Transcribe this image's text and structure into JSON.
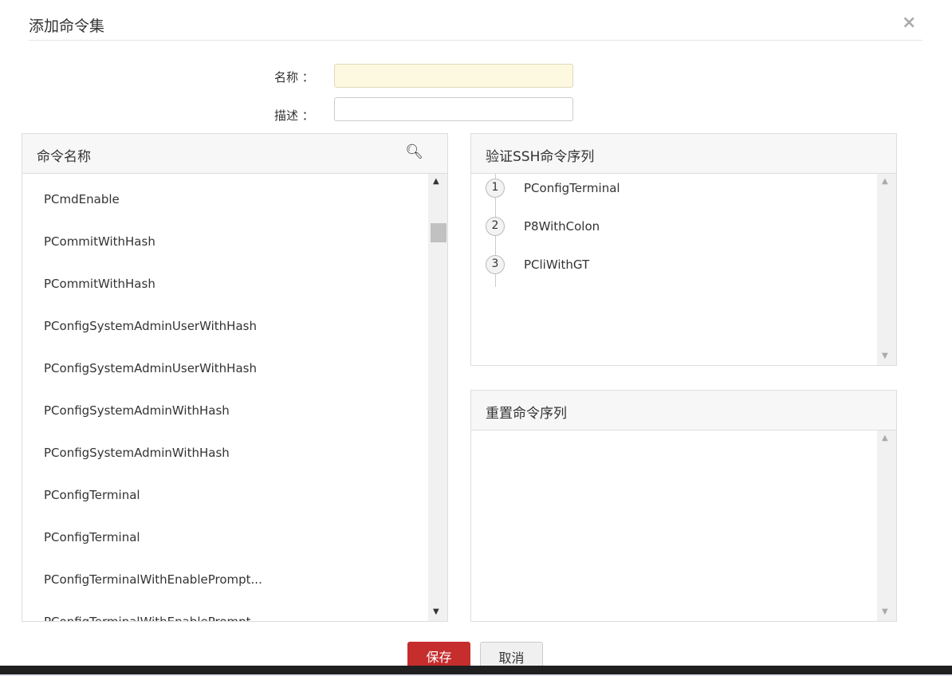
{
  "dialog": {
    "title": "添加命令集",
    "close_icon": "×"
  },
  "form": {
    "name_label": "名称 ：",
    "name_value": "",
    "desc_label": "描述 ：",
    "desc_value": ""
  },
  "commands": {
    "header": "命令名称",
    "items": [
      "PCmdEnable",
      "PCommitWithHash",
      "PCommitWithHash",
      "PConfigSystemAdminUserWithHash",
      "PConfigSystemAdminUserWithHash",
      "PConfigSystemAdminWithHash",
      "PConfigSystemAdminWithHash",
      "PConfigTerminal",
      "PConfigTerminal",
      "PConfigTerminalWithEnablePrompt...",
      "PConfigTerminalWithEnablePrompt..."
    ]
  },
  "verify": {
    "header": "验证SSH命令序列",
    "steps": [
      {
        "n": "1",
        "name": "PConfigTerminal"
      },
      {
        "n": "2",
        "name": "P8WithColon"
      },
      {
        "n": "3",
        "name": "PCliWithGT"
      }
    ]
  },
  "reset": {
    "header": "重置命令序列"
  },
  "buttons": {
    "save": "保存",
    "cancel": "取消"
  }
}
